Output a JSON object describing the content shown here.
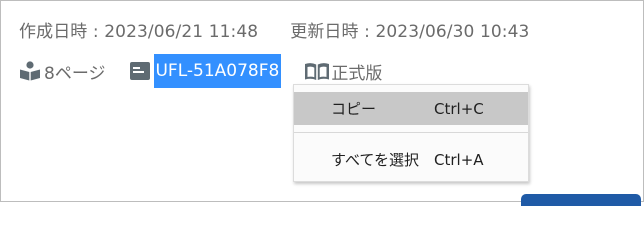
{
  "meta": {
    "created": "作成日時 : 2023/06/21 11:48",
    "updated": "更新日時 : 2023/06/30 10:43"
  },
  "info": {
    "pages_label": "8ページ",
    "code": "UFL-51A078F8",
    "edition": "正式版"
  },
  "context_menu": {
    "items": [
      {
        "label": "コピー",
        "shortcut": "Ctrl+C",
        "highlighted": true
      },
      {
        "label": "すべてを選択",
        "shortcut": "Ctrl+A",
        "highlighted": false
      }
    ]
  },
  "colors": {
    "selection": "#3390ff",
    "text_gray": "#6b6b6b",
    "icon_gray": "#5f6b73",
    "menu_highlight": "#c8c8c8",
    "button_blue": "#1f5aa6"
  },
  "icons": {
    "pages": "book-reader-icon",
    "code": "document-id-icon",
    "edition": "open-book-icon"
  }
}
